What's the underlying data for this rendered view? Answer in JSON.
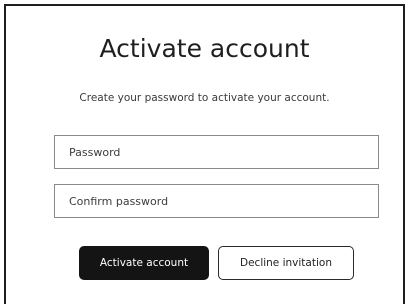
{
  "form": {
    "title": "Activate account",
    "subtitle": "Create your password to activate your account.",
    "password_placeholder": "Password",
    "confirm_placeholder": "Confirm password",
    "password_value": "",
    "confirm_value": ""
  },
  "actions": {
    "activate_label": "Activate account",
    "decline_label": "Decline invitation"
  },
  "colors": {
    "primary_button_bg": "#141414",
    "primary_button_text": "#ffffff",
    "border": "#1e1e1e",
    "field_border": "#8a8a8a"
  }
}
